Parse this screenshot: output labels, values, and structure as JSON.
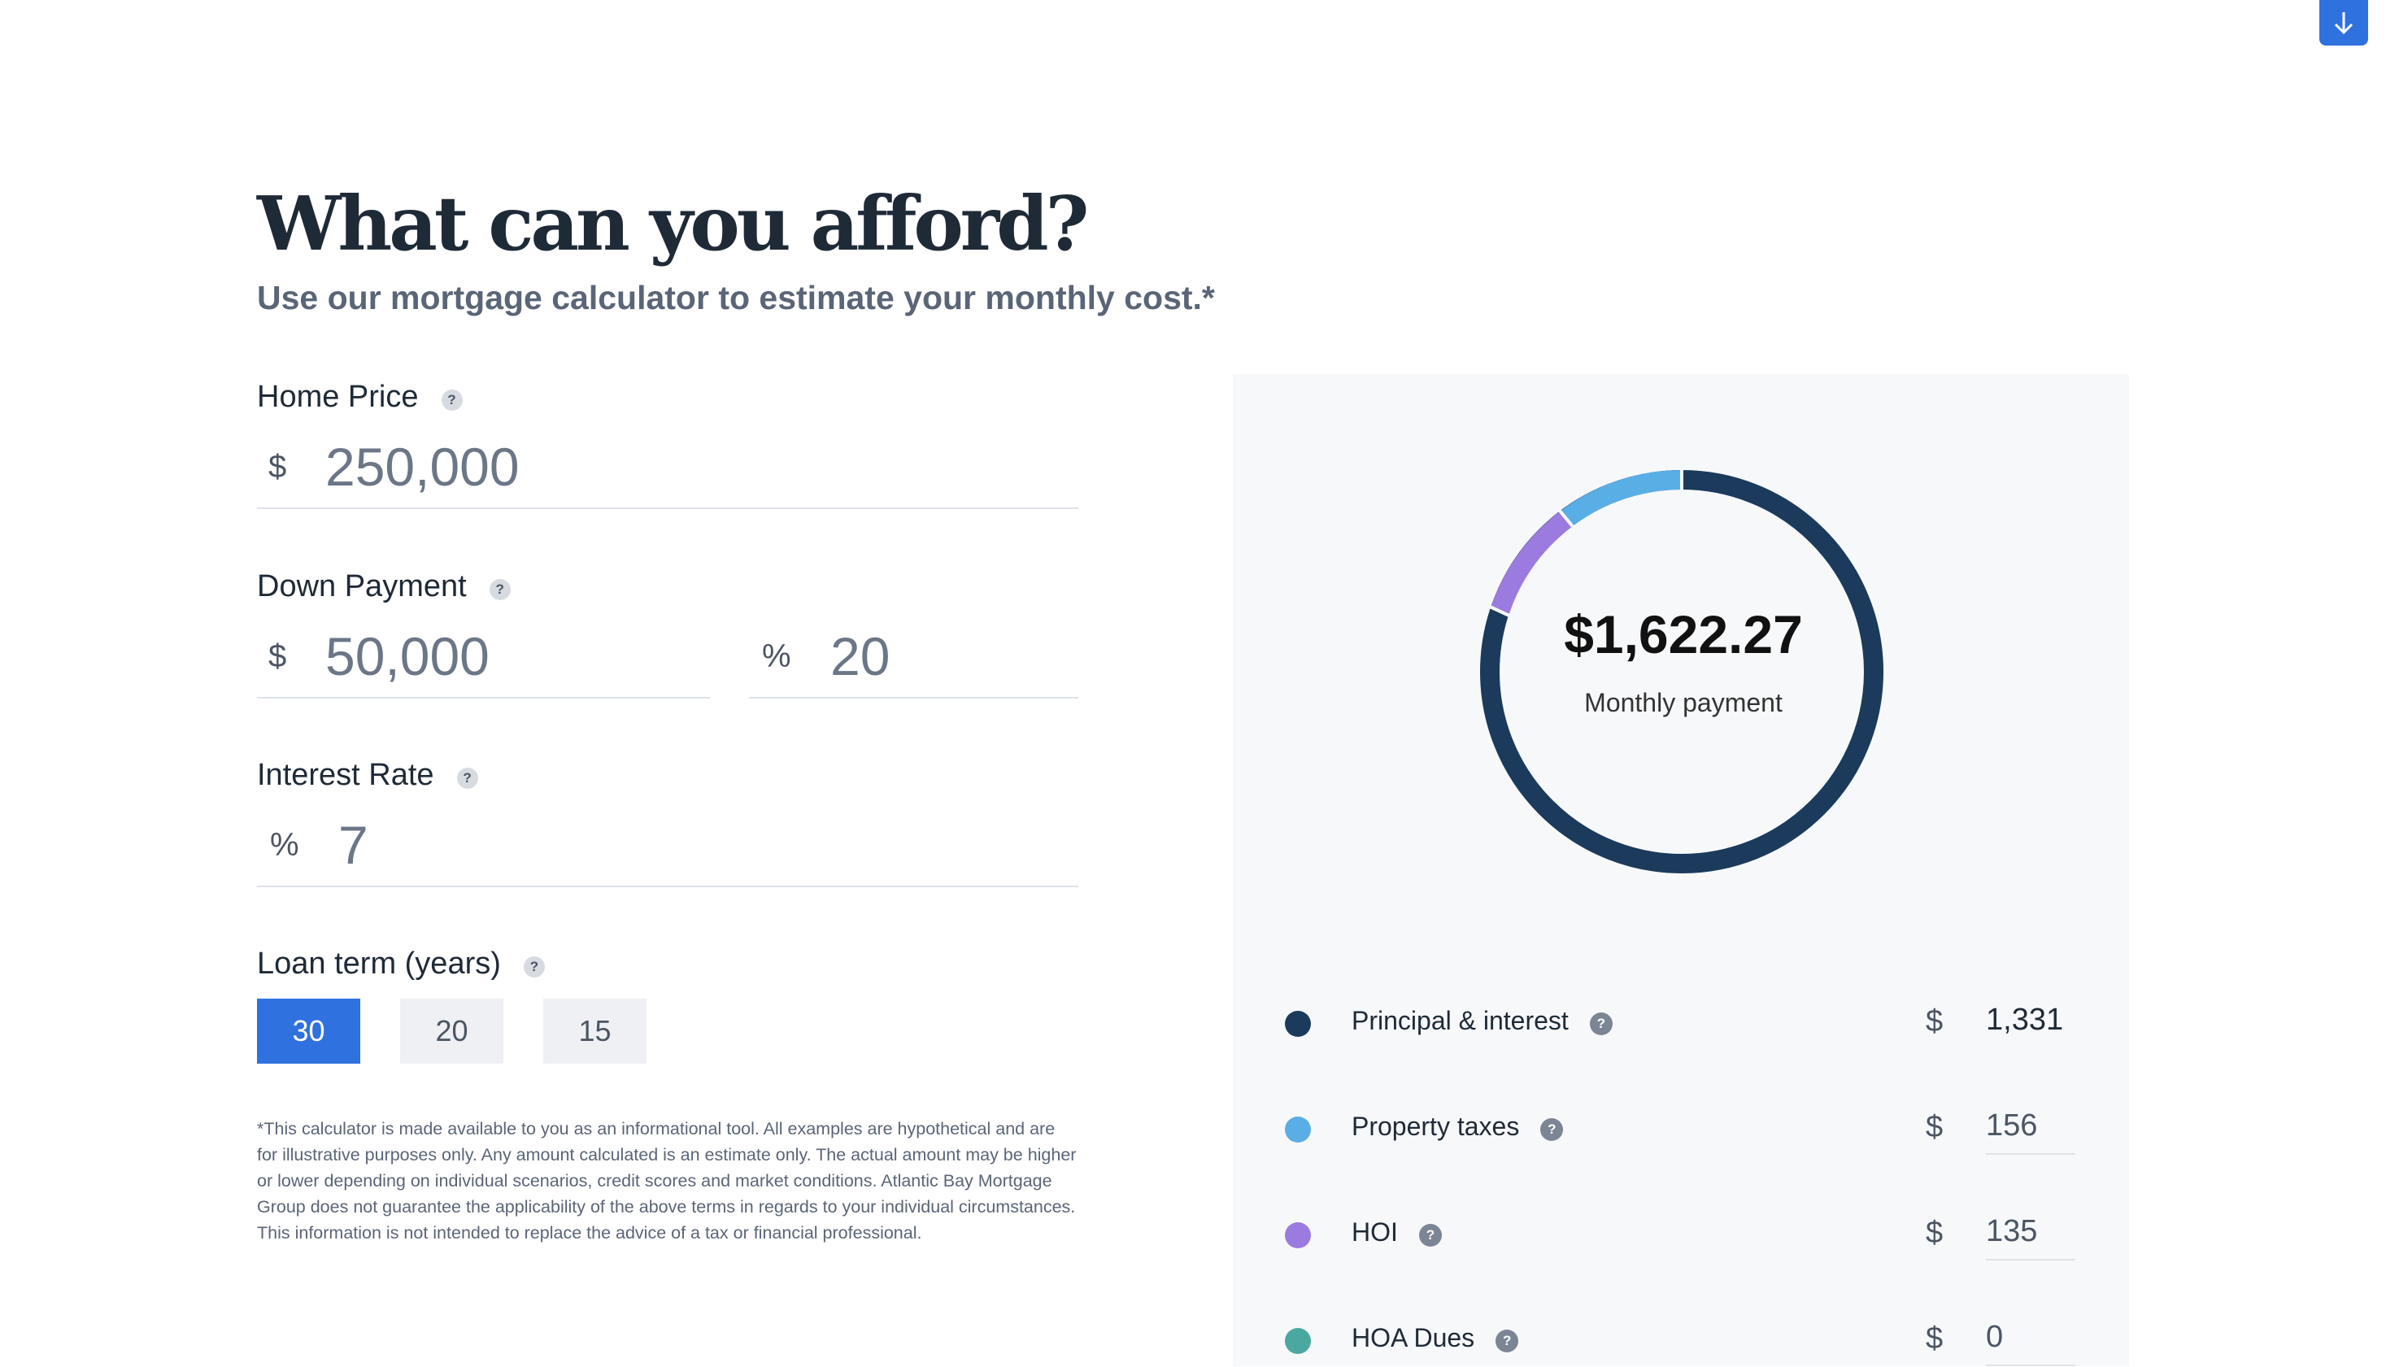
{
  "header": {
    "title": "What can you afford?",
    "subtitle": "Use our mortgage calculator to estimate your monthly cost.*",
    "scroll_icon": "arrow-down-icon"
  },
  "form": {
    "home_price": {
      "label": "Home Price",
      "currency": "$",
      "value": "250,000"
    },
    "down_payment": {
      "label": "Down Payment",
      "currency": "$",
      "amount": "50,000",
      "percent_symbol": "%",
      "percent": "20"
    },
    "interest_rate": {
      "label": "Interest Rate",
      "symbol": "%",
      "value": "7"
    },
    "loan_term": {
      "label": "Loan term (years)",
      "options": [
        "30",
        "20",
        "15"
      ],
      "selected": "30"
    },
    "help_glyph": "?",
    "disclaimer": "*This calculator is made available to you as an informational tool. All examples are hypothetical and are for illustrative purposes only. Any amount calculated is an estimate only. The actual amount may be higher or lower depending on individual scenarios, credit scores and market conditions. Atlantic Bay Mortgage Group does not guarantee the applicability of the above terms in regards to your individual circumstances. This information is not intended to replace the advice of a tax or financial professional."
  },
  "summary": {
    "monthly_payment": "$1,622.27",
    "monthly_payment_label": "Monthly payment",
    "breakdown": [
      {
        "label": "Principal & interest",
        "currency": "$",
        "value": "1,331",
        "color": "#1b3a5c"
      },
      {
        "label": "Property taxes",
        "currency": "$",
        "value": "156",
        "color": "#5aaee6"
      },
      {
        "label": "HOI",
        "currency": "$",
        "value": "135",
        "color": "#9b7be0"
      },
      {
        "label": "HOA Dues",
        "currency": "$",
        "value": "0",
        "color": "#4aa8a0"
      }
    ]
  },
  "colors": {
    "accent": "#3071e0",
    "principal": "#1b3a5c",
    "taxes": "#5aaee6",
    "hoi": "#9b7be0",
    "hoa": "#4aa8a0"
  }
}
